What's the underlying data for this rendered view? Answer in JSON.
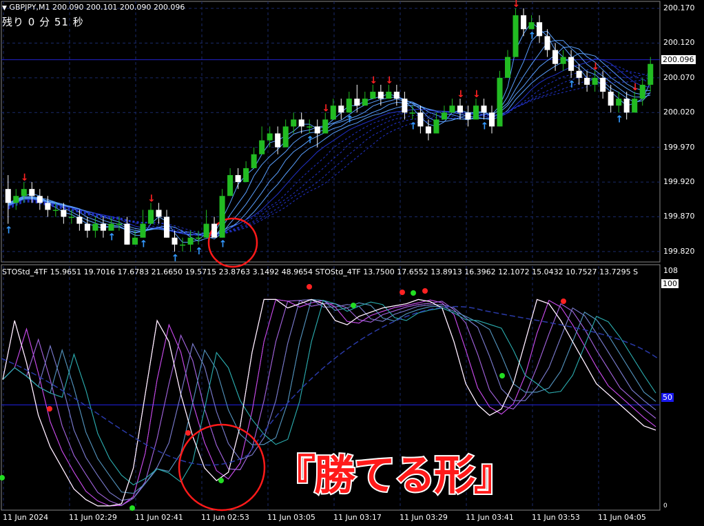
{
  "header": {
    "menu_icon": "triangle-down-icon",
    "symbol_info": "GBPJPY,M1  200.090 200.101 200.090 200.096",
    "countdown": "残り 0 分 51 秒"
  },
  "indicator_header": "STOStd_4TF 15.9651 19.7016 17.6783 21.6650 19.5715 23.8763 3.1492 48.9654  STOStd_4TF 13.7500 17.6552 13.8913 16.3962 12.1072 15.0432 10.7527 13.7295  S",
  "price_axis": {
    "labels": [
      "200.170",
      "200.120",
      "200.070",
      "200.020",
      "199.970",
      "199.920",
      "199.870",
      "199.820"
    ],
    "current_price": "200.096",
    "current_price_color": "#ffffff"
  },
  "indicator_axis": {
    "top_label": "108",
    "max_label": "100",
    "mid_label": "50",
    "bottom_label": "0"
  },
  "time_axis": [
    "11 Jun 2024",
    "11 Jun 02:29",
    "11 Jun 02:41",
    "11 Jun 02:53",
    "11 Jun 03:05",
    "11 Jun 03:17",
    "11 Jun 03:29",
    "11 Jun 03:41",
    "11 Jun 03:53",
    "11 Jun 04:05"
  ],
  "annotation": "『勝てる形』",
  "colors": {
    "background": "#000000",
    "grid": "#1a2a6a",
    "bull": "#22bb22",
    "bear": "#ffffff",
    "up_arrow": "#3399ff",
    "down_arrow": "#ff2222",
    "circle": "#ff1a1a",
    "blue_line": "#2222cc"
  },
  "chart_data": {
    "type": "candlestick",
    "title": "GBPJPY,M1",
    "ylim": [
      199.805,
      200.18
    ],
    "indicator_ylim": [
      0,
      108
    ],
    "last_close": 200.096,
    "candles": [
      [
        199.91,
        199.89,
        199.93,
        199.86
      ],
      [
        199.89,
        199.9,
        199.91,
        199.88
      ],
      [
        199.9,
        199.91,
        199.92,
        199.89
      ],
      [
        199.91,
        199.9,
        199.92,
        199.89
      ],
      [
        199.9,
        199.89,
        199.91,
        199.88
      ],
      [
        199.89,
        199.88,
        199.9,
        199.87
      ],
      [
        199.88,
        199.88,
        199.89,
        199.87
      ],
      [
        199.88,
        199.87,
        199.89,
        199.86
      ],
      [
        199.87,
        199.87,
        199.88,
        199.86
      ],
      [
        199.87,
        199.86,
        199.88,
        199.85
      ],
      [
        199.86,
        199.85,
        199.87,
        199.84
      ],
      [
        199.85,
        199.86,
        199.87,
        199.84
      ],
      [
        199.86,
        199.85,
        199.87,
        199.84
      ],
      [
        199.85,
        199.86,
        199.87,
        199.85
      ],
      [
        199.86,
        199.86,
        199.87,
        199.85
      ],
      [
        199.86,
        199.83,
        199.87,
        199.83
      ],
      [
        199.83,
        199.84,
        199.85,
        199.83
      ],
      [
        199.84,
        199.86,
        199.88,
        199.84
      ],
      [
        199.86,
        199.88,
        199.89,
        199.86
      ],
      [
        199.88,
        199.87,
        199.89,
        199.86
      ],
      [
        199.87,
        199.84,
        199.88,
        199.84
      ],
      [
        199.84,
        199.83,
        199.85,
        199.82
      ],
      [
        199.83,
        199.83,
        199.84,
        199.82
      ],
      [
        199.83,
        199.84,
        199.85,
        199.82
      ],
      [
        199.84,
        199.84,
        199.85,
        199.83
      ],
      [
        199.84,
        199.86,
        199.88,
        199.84
      ],
      [
        199.86,
        199.84,
        199.87,
        199.84
      ],
      [
        199.84,
        199.9,
        199.91,
        199.84
      ],
      [
        199.9,
        199.93,
        199.94,
        199.9
      ],
      [
        199.93,
        199.92,
        199.94,
        199.91
      ],
      [
        199.92,
        199.94,
        199.95,
        199.92
      ],
      [
        199.94,
        199.96,
        199.97,
        199.94
      ],
      [
        199.96,
        199.98,
        200.0,
        199.96
      ],
      [
        199.98,
        199.99,
        200.0,
        199.97
      ],
      [
        199.99,
        199.97,
        200.0,
        199.96
      ],
      [
        199.97,
        200.0,
        200.01,
        199.97
      ],
      [
        200.0,
        200.01,
        200.02,
        199.99
      ],
      [
        200.01,
        200.0,
        200.02,
        199.99
      ],
      [
        200.0,
        200.0,
        200.01,
        199.99
      ],
      [
        200.0,
        199.99,
        200.01,
        199.97
      ],
      [
        199.99,
        200.01,
        200.02,
        199.99
      ],
      [
        200.01,
        200.03,
        200.04,
        200.01
      ],
      [
        200.03,
        200.02,
        200.04,
        200.01
      ],
      [
        200.02,
        200.04,
        200.05,
        200.02
      ],
      [
        200.04,
        200.03,
        200.06,
        200.02
      ],
      [
        200.03,
        200.04,
        200.05,
        200.03
      ],
      [
        200.04,
        200.05,
        200.06,
        200.04
      ],
      [
        200.05,
        200.04,
        200.06,
        200.03
      ],
      [
        200.04,
        200.05,
        200.06,
        200.04
      ],
      [
        200.05,
        200.04,
        200.06,
        200.03
      ],
      [
        200.04,
        200.02,
        200.05,
        200.01
      ],
      [
        200.02,
        200.02,
        200.03,
        200.01
      ],
      [
        200.02,
        200.0,
        200.03,
        199.99
      ],
      [
        200.0,
        199.99,
        200.01,
        199.98
      ],
      [
        199.99,
        200.01,
        200.02,
        199.99
      ],
      [
        200.01,
        200.02,
        200.03,
        200.01
      ],
      [
        200.02,
        200.03,
        200.04,
        200.02
      ],
      [
        200.03,
        200.02,
        200.04,
        200.01
      ],
      [
        200.02,
        200.01,
        200.03,
        200.0
      ],
      [
        200.01,
        200.03,
        200.04,
        200.01
      ],
      [
        200.03,
        200.02,
        200.04,
        200.01
      ],
      [
        200.02,
        200.0,
        200.03,
        199.99
      ],
      [
        200.0,
        200.07,
        200.08,
        200.0
      ],
      [
        200.07,
        200.1,
        200.11,
        200.07
      ],
      [
        200.1,
        200.16,
        200.17,
        200.1
      ],
      [
        200.16,
        200.14,
        200.17,
        200.13
      ],
      [
        200.14,
        200.15,
        200.16,
        200.14
      ],
      [
        200.15,
        200.13,
        200.16,
        200.12
      ],
      [
        200.13,
        200.11,
        200.14,
        200.1
      ],
      [
        200.11,
        200.09,
        200.12,
        200.08
      ],
      [
        200.09,
        200.1,
        200.11,
        200.08
      ],
      [
        200.1,
        200.08,
        200.11,
        200.07
      ],
      [
        200.08,
        200.07,
        200.09,
        200.06
      ],
      [
        200.07,
        200.06,
        200.08,
        200.05
      ],
      [
        200.06,
        200.07,
        200.08,
        200.05
      ],
      [
        200.07,
        200.05,
        200.08,
        200.04
      ],
      [
        200.05,
        200.03,
        200.06,
        200.02
      ],
      [
        200.03,
        200.04,
        200.05,
        200.02
      ],
      [
        200.04,
        200.02,
        200.05,
        200.01
      ],
      [
        200.02,
        200.04,
        200.05,
        200.02
      ],
      [
        200.04,
        200.06,
        200.07,
        200.03
      ],
      [
        200.06,
        200.09,
        200.1,
        200.05
      ]
    ]
  }
}
